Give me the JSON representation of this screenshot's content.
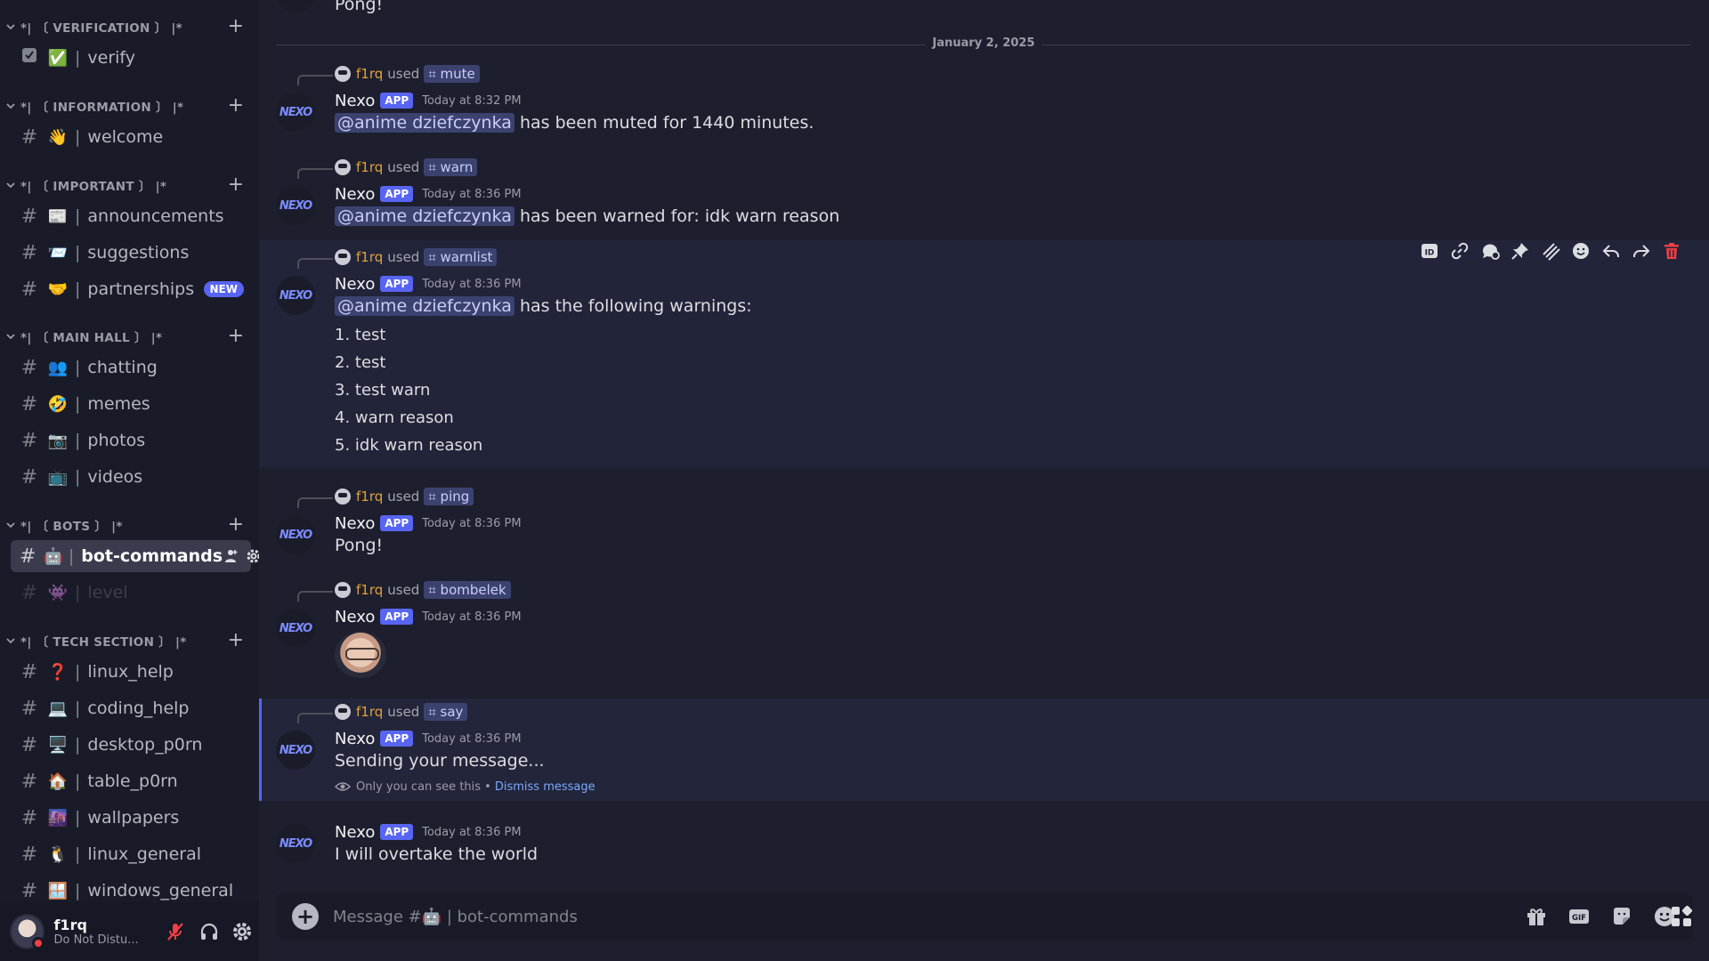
{
  "sidebar": {
    "categories": [
      {
        "name": "*| 〔 VERIFICATION 〕 |*"
      },
      {
        "name": "*| 〔 INFORMATION 〕 |*"
      },
      {
        "name": "*| 〔 IMPORTANT 〕 |*"
      },
      {
        "name": "*| 〔 MAIN HALL 〕 |*"
      },
      {
        "name": "*| 〔 BOTS 〕 |*"
      },
      {
        "name": "*| 〔 TECH SECTION 〕 |*"
      }
    ],
    "category_plus": "+",
    "channels": [
      {
        "emoji": "✅",
        "sep": "|",
        "name": "verify"
      },
      {
        "emoji": "👋",
        "sep": "|",
        "name": "welcome"
      },
      {
        "emoji": "📰",
        "sep": "|",
        "name": "announcements"
      },
      {
        "emoji": "📨",
        "sep": "|",
        "name": "suggestions"
      },
      {
        "emoji": "🤝",
        "sep": "|",
        "name": "partnerships",
        "badge": "NEW"
      },
      {
        "emoji": "👥",
        "sep": "|",
        "name": "chatting"
      },
      {
        "emoji": "🤣",
        "sep": "|",
        "name": "memes"
      },
      {
        "emoji": "📷",
        "sep": "|",
        "name": "photos"
      },
      {
        "emoji": "📺",
        "sep": "|",
        "name": "videos"
      },
      {
        "emoji": "🤖",
        "sep": "|",
        "name": "bot-commands"
      },
      {
        "emoji": "👾",
        "sep": "|",
        "name": "level"
      },
      {
        "emoji": "❓",
        "sep": "|",
        "name": "linux_help"
      },
      {
        "emoji": "💻",
        "sep": "|",
        "name": "coding_help"
      },
      {
        "emoji": "🖥️",
        "sep": "|",
        "name": "desktop_p0rn"
      },
      {
        "emoji": "🏠",
        "sep": "|",
        "name": "table_p0rn"
      },
      {
        "emoji": "🌆",
        "sep": "|",
        "name": "wallpapers"
      },
      {
        "emoji": "🐧",
        "sep": "|",
        "name": "linux_general"
      },
      {
        "emoji": "🪟",
        "sep": "|",
        "name": "windows_general"
      }
    ],
    "hash": "#",
    "user": {
      "name": "f1rq",
      "status": "Do Not Distu..."
    }
  },
  "chat": {
    "top_partial": "Pong!",
    "date_divider": "January 2, 2025",
    "bot_name": "Nexo",
    "app_tag": "APP",
    "avatar_text": "NEXO",
    "used_word": "used",
    "invoker": "f1rq",
    "messages": [
      {
        "cmd": "⌗ mute",
        "time": "Today at 8:32 PM",
        "mention": "@anime dziefczynka",
        "text": "has been muted for 1440 minutes."
      },
      {
        "cmd": "⌗ warn",
        "time": "Today at 8:36 PM",
        "mention": "@anime dziefczynka",
        "text": "has been warned for: idk warn reason"
      },
      {
        "cmd": "⌗ warnlist",
        "time": "Today at 8:36 PM",
        "mention": "@anime dziefczynka",
        "text": "has the following warnings:",
        "warnings": [
          "1. test",
          "2. test",
          "3. test warn",
          "4. warn reason",
          "5. idk warn reason"
        ]
      },
      {
        "cmd": "⌗ ping",
        "time": "Today at 8:36 PM",
        "text": "Pong!"
      },
      {
        "cmd": "⌗ bombelek",
        "time": "Today at 8:36 PM"
      },
      {
        "cmd": "⌗ say",
        "time": "Today at 8:36 PM",
        "text": "Sending your message...",
        "note": "Only you can see this •",
        "dismiss": "Dismiss message"
      },
      {
        "time": "Today at 8:36 PM",
        "text": "I will overtake the world"
      }
    ]
  },
  "composer": {
    "placeholder": "Message #🤖 | bot-commands",
    "plus": "+",
    "gif": "GIF"
  },
  "colors": {
    "accent": "#5865f2",
    "bg": "#1e1f2e",
    "sidebar": "#1a1b28",
    "delete": "#f23f43",
    "invoker": "#e0a23e"
  }
}
